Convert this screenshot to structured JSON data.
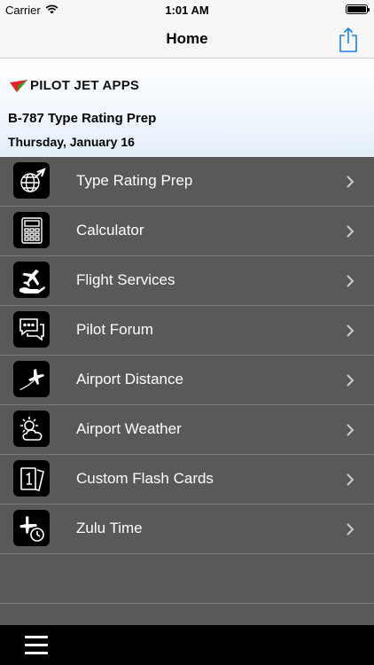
{
  "status_bar": {
    "carrier": "Carrier",
    "time": "1:01 AM"
  },
  "nav": {
    "title": "Home"
  },
  "header": {
    "logo_text": "PILOT JET APPS",
    "app_title": "B-787 Type Rating Prep",
    "date": "Thursday, January 16"
  },
  "menu": {
    "items": [
      {
        "label": "Type Rating Prep",
        "icon": "globe-plane-icon"
      },
      {
        "label": "Calculator",
        "icon": "calculator-icon"
      },
      {
        "label": "Flight Services",
        "icon": "hand-plane-icon"
      },
      {
        "label": "Pilot Forum",
        "icon": "chat-bubbles-icon"
      },
      {
        "label": "Airport Distance",
        "icon": "plane-departure-icon"
      },
      {
        "label": "Airport Weather",
        "icon": "sun-cloud-icon"
      },
      {
        "label": "Custom Flash Cards",
        "icon": "flash-cards-icon"
      },
      {
        "label": "Zulu Time",
        "icon": "plane-clock-icon"
      }
    ]
  },
  "colors": {
    "menu_background": "#595959",
    "accent_blue": "#1a82e0",
    "logo_red": "#e0242a",
    "logo_green": "#3a9a2a"
  }
}
